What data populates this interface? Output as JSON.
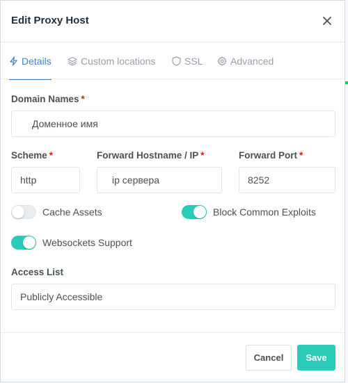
{
  "modal": {
    "title": "Edit Proxy Host"
  },
  "tabs": [
    {
      "label": "Details",
      "icon": "bolt-icon",
      "active": true
    },
    {
      "label": "Custom locations",
      "icon": "layers-icon",
      "active": false
    },
    {
      "label": "SSL",
      "icon": "shield-icon",
      "active": false
    },
    {
      "label": "Advanced",
      "icon": "gear-icon",
      "active": false
    }
  ],
  "form": {
    "domain_names": {
      "label": "Domain Names",
      "required_mark": "*",
      "value": "Доменное имя"
    },
    "scheme": {
      "label": "Scheme",
      "required_mark": "*",
      "value": "http"
    },
    "forward_host": {
      "label": "Forward Hostname / IP",
      "required_mark": "*",
      "value": "ip сервера"
    },
    "forward_port": {
      "label": "Forward Port",
      "required_mark": "*",
      "value": "8252"
    },
    "cache_assets": {
      "label": "Cache Assets",
      "enabled": false
    },
    "block_exploits": {
      "label": "Block Common Exploits",
      "enabled": true
    },
    "websockets": {
      "label": "Websockets Support",
      "enabled": true
    },
    "access_list": {
      "label": "Access List",
      "value": "Publicly Accessible"
    }
  },
  "footer": {
    "cancel_label": "Cancel",
    "save_label": "Save"
  },
  "colors": {
    "accent": "#467fcf",
    "toggle_on": "#2bcbba",
    "required": "#cd201f"
  }
}
